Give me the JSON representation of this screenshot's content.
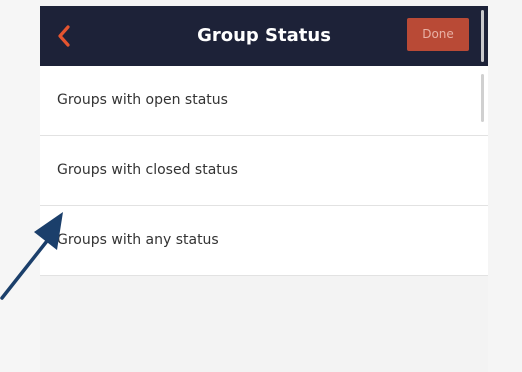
{
  "header": {
    "title": "Group Status",
    "done_label": "Done"
  },
  "options": [
    {
      "label": "Groups with open status"
    },
    {
      "label": "Groups with closed status"
    },
    {
      "label": "Groups with any status"
    }
  ],
  "colors": {
    "navbar": "#1d2238",
    "accent": "#e4542f",
    "done_button": "#b94a36",
    "annotation_arrow": "#1b3f6b"
  },
  "icons": {
    "back": "chevron-left-icon",
    "annotation": "pointer-arrow-icon"
  }
}
